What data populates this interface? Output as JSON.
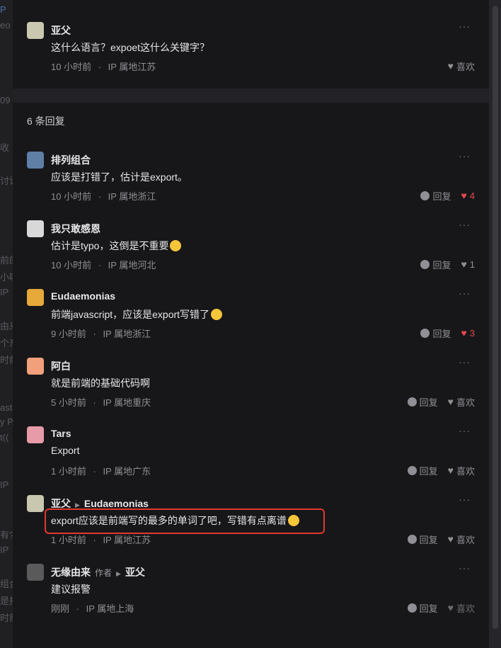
{
  "background_fragments": [
    "P",
    "eo",
    "09",
    "收",
    "讨论",
    "前的",
    "小呢",
    "IP",
    "由来",
    "个东",
    "时前",
    "ast",
    "y P",
    "t((",
    "IP",
    "有?",
    "IP",
    "组合",
    "是打",
    "时前"
  ],
  "root_comment": {
    "name": "亚父",
    "text": "这什么语言？expoet这什么关键字？",
    "time": "10 小时前",
    "ip": "IP 属地江苏",
    "like_label": "喜欢"
  },
  "replies_heading": "6 条回复",
  "dot_sep": "·",
  "more_label": "···",
  "reply_label": "回复",
  "replies": [
    {
      "name": "排列组合",
      "text": "应该是打错了，估计是export。",
      "time": "10 小时前",
      "ip": "IP 属地浙江",
      "like": "4",
      "liked": true
    },
    {
      "name": "我只敢感恩",
      "text": "估计是typo，这倒是不重要",
      "emoji": "laughing-emoji",
      "time": "10 小时前",
      "ip": "IP 属地河北",
      "like": "1",
      "liked": false
    },
    {
      "name": "Eudaemonias",
      "text": "前端javascript，应该是export写错了",
      "emoji": "rofl-emoji",
      "time": "9 小时前",
      "ip": "IP 属地浙江",
      "like": "3",
      "liked": true
    },
    {
      "name": "阿白",
      "text": "就是前端的基础代码啊",
      "time": "5 小时前",
      "ip": "IP 属地重庆",
      "like": "喜欢",
      "liked": false
    },
    {
      "name": "Tars",
      "text": "Export",
      "time": "1 小时前",
      "ip": "IP 属地广东",
      "like": "喜欢",
      "liked": false
    },
    {
      "name": "亚父",
      "reply_to": "Eudaemonias",
      "text": "export应该是前端写的最多的单词了吧，写错有点离谱",
      "emoji": "grimace-emoji",
      "time": "1 小时前",
      "ip": "IP 属地江苏",
      "like": "喜欢",
      "liked": false
    },
    {
      "name": "无缘由来",
      "author_tag": "作者",
      "reply_to": "亚父",
      "text": "建议报警",
      "time": "刚刚",
      "ip": "IP 属地上海",
      "like": "喜欢",
      "liked": false
    }
  ],
  "colors": {
    "accent_red": "#e5484d",
    "highlight_border": "#e0392f",
    "background": "#171719"
  }
}
